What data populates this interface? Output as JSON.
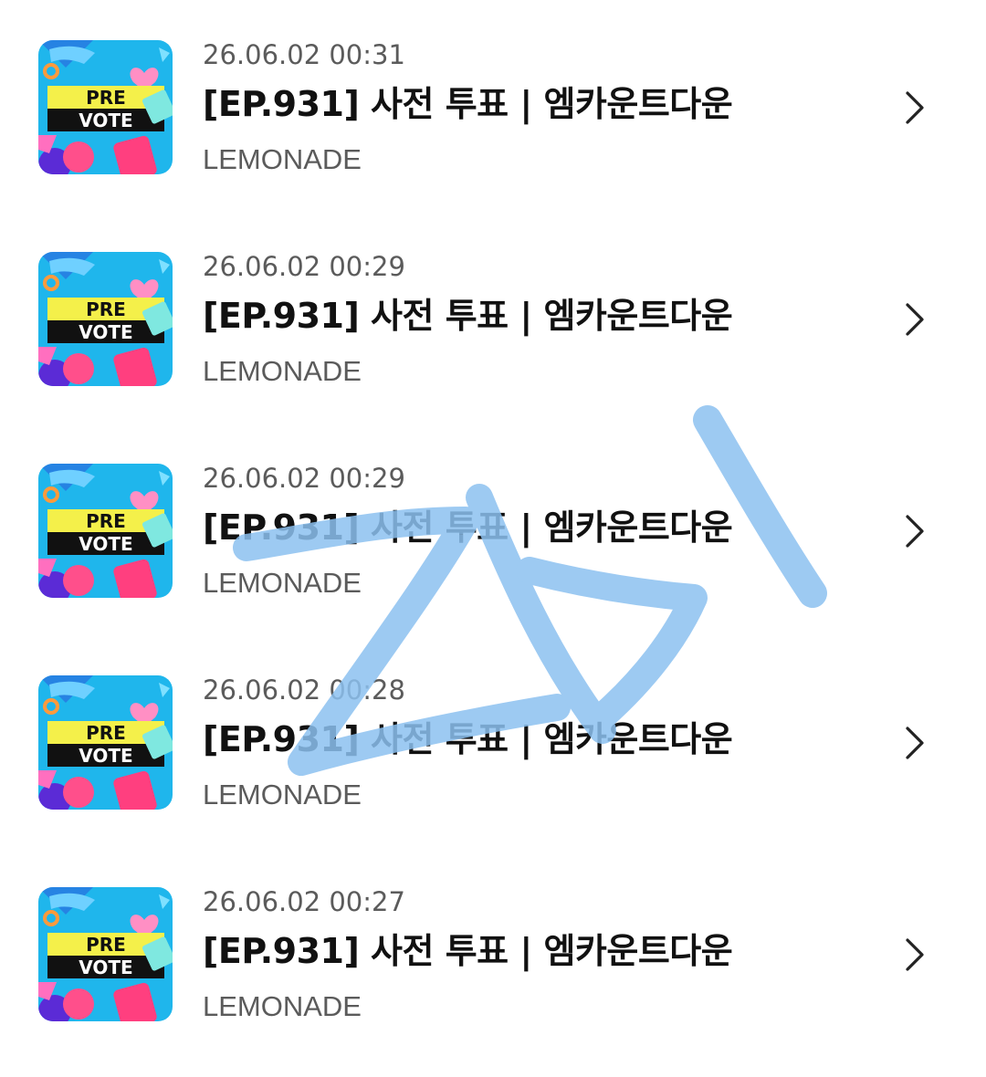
{
  "items": [
    {
      "thumbnail": {
        "line1": "PRE",
        "line2": "VOTE"
      },
      "date": "26.06.02 00:31",
      "title": "[EP.931] 사전 투표 | 엠카운트다운",
      "artist": "LEMONADE",
      "chevron_icon": "chevron-right-icon"
    },
    {
      "thumbnail": {
        "line1": "PRE",
        "line2": "VOTE"
      },
      "date": "26.06.02 00:29",
      "title": "[EP.931] 사전 투표 | 엠카운트다운",
      "artist": "LEMONADE",
      "chevron_icon": "chevron-right-icon"
    },
    {
      "thumbnail": {
        "line1": "PRE",
        "line2": "VOTE"
      },
      "date": "26.06.02 00:29",
      "title": "[EP.931] 사전 투표 | 엠카운트다운",
      "artist": "LEMONADE",
      "chevron_icon": "chevron-right-icon"
    },
    {
      "thumbnail": {
        "line1": "PRE",
        "line2": "VOTE"
      },
      "date": "26.06.02 00:28",
      "title": "[EP.931] 사전 투표 | 엠카운트다운",
      "artist": "LEMONADE",
      "chevron_icon": "chevron-right-icon"
    },
    {
      "thumbnail": {
        "line1": "PRE",
        "line2": "VOTE"
      },
      "date": "26.06.02 00:27",
      "title": "[EP.931] 사전 투표 | 엠카운트다운",
      "artist": "LEMONADE",
      "chevron_icon": "chevron-right-icon"
    }
  ],
  "colors": {
    "thumbnail_bg": "#1fb6ec",
    "banner_yellow": "#f4f04a",
    "banner_black": "#111111",
    "heart_pink": "#ff8fc4",
    "scribble_blue": "#8cc1f0"
  }
}
